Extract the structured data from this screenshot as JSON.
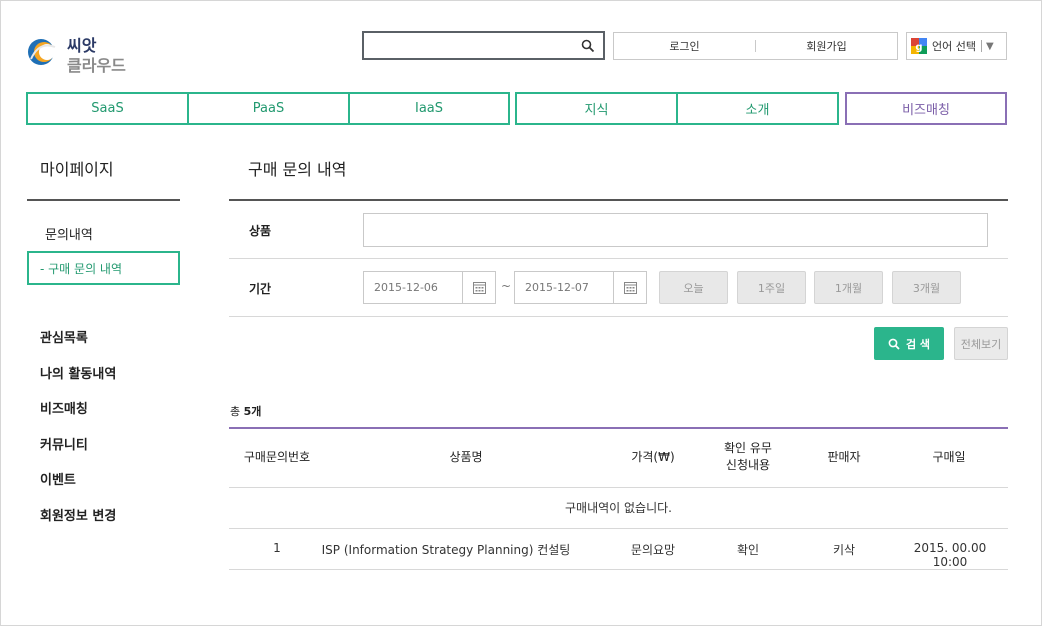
{
  "header": {
    "logo_line1": "씨앗",
    "logo_line2": "클라우드",
    "search_placeholder": "",
    "login_label": "로그인",
    "signup_label": "회원가입",
    "language_label": "언어 선택",
    "language_caret": "▼"
  },
  "nav": {
    "group1": [
      "SaaS",
      "PaaS",
      "IaaS"
    ],
    "group2": [
      "지식",
      "소개"
    ],
    "group3": [
      "비즈매칭"
    ]
  },
  "sidebar": {
    "title": "마이페이지",
    "sub_title": "문의내역",
    "active_item": "- 구매 문의 내역",
    "items": [
      "관심목록",
      "나의 활동내역",
      "비즈매칭",
      "커뮤니티",
      "이벤트",
      "회원정보 변경"
    ]
  },
  "main": {
    "title": "구매 문의 내역",
    "product_label": "상품",
    "product_value": "",
    "period_label": "기간",
    "date_from": "2015-12-06",
    "date_to": "2015-12-07",
    "date_separator": "~",
    "quick_ranges": [
      "오늘",
      "1주일",
      "1개월",
      "3개월"
    ],
    "search_button": "검 색",
    "show_all_button": "전체보기",
    "total_prefix": "총",
    "total_count": "5개"
  },
  "table": {
    "headers": [
      "구매문의번호",
      "상품명",
      "가격(₩)",
      "확인 유무",
      "신청내용",
      "판매자",
      "구매일"
    ],
    "empty_message": "구매내역이 없습니다.",
    "rows": [
      {
        "number": "1",
        "product": "ISP (Information Strategy Planning) 컨설팅",
        "price": "문의요망",
        "status": "확인",
        "seller": "키삭",
        "date": "2015. 00.00 10:00"
      }
    ]
  },
  "colors": {
    "accent_green": "#2bb58c",
    "accent_purple": "#8a6fb5"
  }
}
